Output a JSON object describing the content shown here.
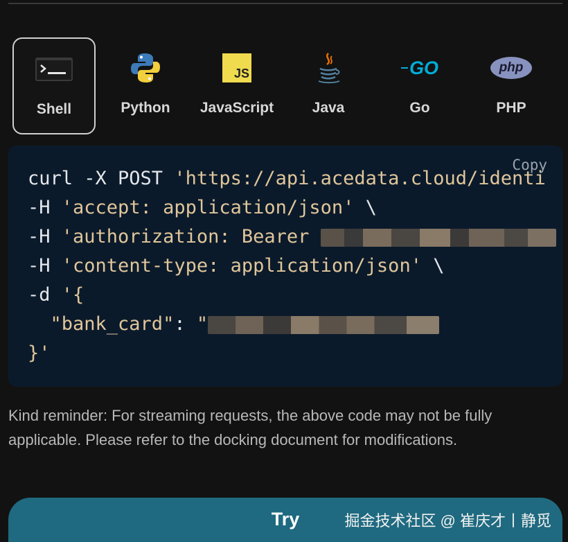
{
  "tabs": [
    {
      "label": "Shell",
      "icon": "terminal-icon",
      "active": true
    },
    {
      "label": "Python",
      "icon": "python-icon",
      "active": false
    },
    {
      "label": "JavaScript",
      "icon": "javascript-icon",
      "active": false
    },
    {
      "label": "Java",
      "icon": "java-icon",
      "active": false
    },
    {
      "label": "Go",
      "icon": "go-icon",
      "active": false
    },
    {
      "label": "PHP",
      "icon": "php-icon",
      "active": false
    }
  ],
  "icon_text": {
    "terminal": ">_",
    "javascript": "JS",
    "go": "GO",
    "php": "php"
  },
  "code": {
    "copy_label": "Copy",
    "line1_cmd": "curl -X POST ",
    "line1_url": "'https://api.acedata.cloud/identi",
    "line2_flag": "-H ",
    "line2_str": "'accept: application/json'",
    "line2_tail": " \\",
    "line3_flag": "-H ",
    "line3_str": "'authorization: Bearer ",
    "line4_flag": "-H ",
    "line4_str": "'content-type: application/json'",
    "line4_tail": " \\",
    "line5_flag": "-d ",
    "line5_str": "'{",
    "line6_key": "  \"bank_card\"",
    "line6_colon": ": ",
    "line6_str": "\"",
    "line7": "}'"
  },
  "reminder": "Kind reminder: For streaming requests, the above code may not be fully applicable. Please refer to the docking document for modifications.",
  "try_button": {
    "label": "Try"
  },
  "watermark": "掘金技术社区 @ 崔庆才丨静觅",
  "colors": {
    "background": "#121212",
    "code_background": "#0b1a2b",
    "string": "#e0c69a",
    "try_button": "#1f6a80",
    "js_yellow": "#f0db4f",
    "go_cyan": "#00add8",
    "php_purple": "#8892bf"
  }
}
